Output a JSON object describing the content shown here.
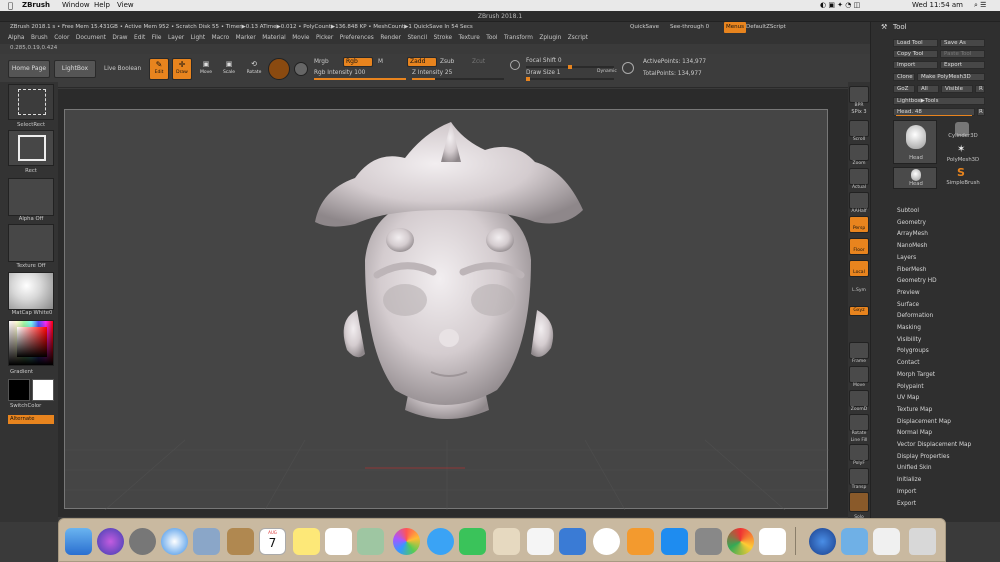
{
  "macmenu": {
    "app": "ZBrush",
    "items": [
      "Window",
      "Help",
      "View"
    ],
    "clock": "Wed 11:54 am"
  },
  "title": "ZBrush 2018.1",
  "info": {
    "version": "ZBrush 2018.1 s",
    "free_mem": "• Free Mem 15.431GB",
    "active_mem": "• Active Mem 952",
    "scratch": "• Scratch Disk 55",
    "timer": "• Timer▶0.13 ATime▶0.012",
    "polycount": "• PolyCount▶136.848 KP",
    "meshcount": "• MeshCount▶1",
    "quicksave": "QuickSave In 54 Secs",
    "quicksave_btn": "QuickSave",
    "seethrough": "See-through  0",
    "menus": "Menus",
    "default_zscript": "DefaultZScript"
  },
  "menu": [
    "Alpha",
    "Brush",
    "Color",
    "Document",
    "Draw",
    "Edit",
    "File",
    "Layer",
    "Light",
    "Macro",
    "Marker",
    "Material",
    "Movie",
    "Picker",
    "Preferences",
    "Render",
    "Stencil",
    "Stroke",
    "Texture",
    "Tool",
    "Transform",
    "Zplugin",
    "Zscript"
  ],
  "coords": "0.285,0.19,0.424",
  "toolbar": {
    "home": "Home Page",
    "lightbox": "LightBox",
    "live_boolean": "Live Boolean",
    "edit": "Edit",
    "draw": "Draw",
    "move": "Move",
    "scale": "Scale",
    "rotate": "Rotate",
    "mrgb": "Mrgb",
    "rgb": "Rgb",
    "m": "M",
    "zadd": "Zadd",
    "zsub": "Zsub",
    "zcut": "Zcut",
    "rgb_intensity": "Rgb Intensity 100",
    "z_intensity": "Z Intensity 25",
    "focal_shift": "Focal Shift 0",
    "draw_size": "Draw Size 1",
    "dynamic": "Dynamic",
    "active_points": "ActivePoints: 134,977",
    "total_points": "TotalPoints: 134,977",
    "rgb_intensity_value": 1.0,
    "z_intensity_value": 0.25
  },
  "left": {
    "select_rect": "SelectRect",
    "rect": "Rect",
    "alpha_off": "Alpha Off",
    "texture_off": "Texture Off",
    "matcap": "MatCap White0",
    "gradient": "Gradient",
    "switchcolor": "SwitchColor",
    "alternate": "Alternate"
  },
  "shelf": [
    "BPR",
    "SPix 3",
    "Scroll",
    "Zoom",
    "Actual",
    "AAHalf",
    "Persp",
    "Floor",
    "Local",
    "L.Sym",
    "Gxyz",
    "",
    "Frame",
    "Move",
    "ZoomD",
    "Rotate",
    "Line Fill",
    "PolyF",
    "Transp",
    "",
    "Solo"
  ],
  "tool": {
    "header": "Tool",
    "load": "Load Tool",
    "save_as": "Save As",
    "copy": "Copy Tool",
    "paste": "Paste Tool",
    "import": "Import",
    "export": "Export",
    "clone": "Clone",
    "make_polymesh": "Make PolyMesh3D",
    "goz": "GoZ",
    "all": "All",
    "visible": "Visible",
    "r": "R",
    "lightbox_tools": "Lightbox▶Tools",
    "head_label": "Head. 48",
    "thumbs": [
      "Head",
      "Cylinder3D",
      "PolyMesh3D",
      "Head",
      "SimpleBrush"
    ],
    "items": [
      "Subtool",
      "Geometry",
      "ArrayMesh",
      "NanoMesh",
      "Layers",
      "FiberMesh",
      "Geometry HD",
      "Preview",
      "Surface",
      "Deformation",
      "Masking",
      "Visibility",
      "Polygroups",
      "Contact",
      "Morph Target",
      "Polypaint",
      "UV Map",
      "Texture Map",
      "Displacement Map",
      "Normal Map",
      "Vector Displacement Map",
      "Display Properties",
      "Unified Skin",
      "Initialize",
      "Import",
      "Export"
    ]
  },
  "dock": {
    "calendar_month": "AUG",
    "calendar_day": "7"
  },
  "colors": {
    "accent": "#e8841e",
    "bg": "#3a3a3a"
  }
}
